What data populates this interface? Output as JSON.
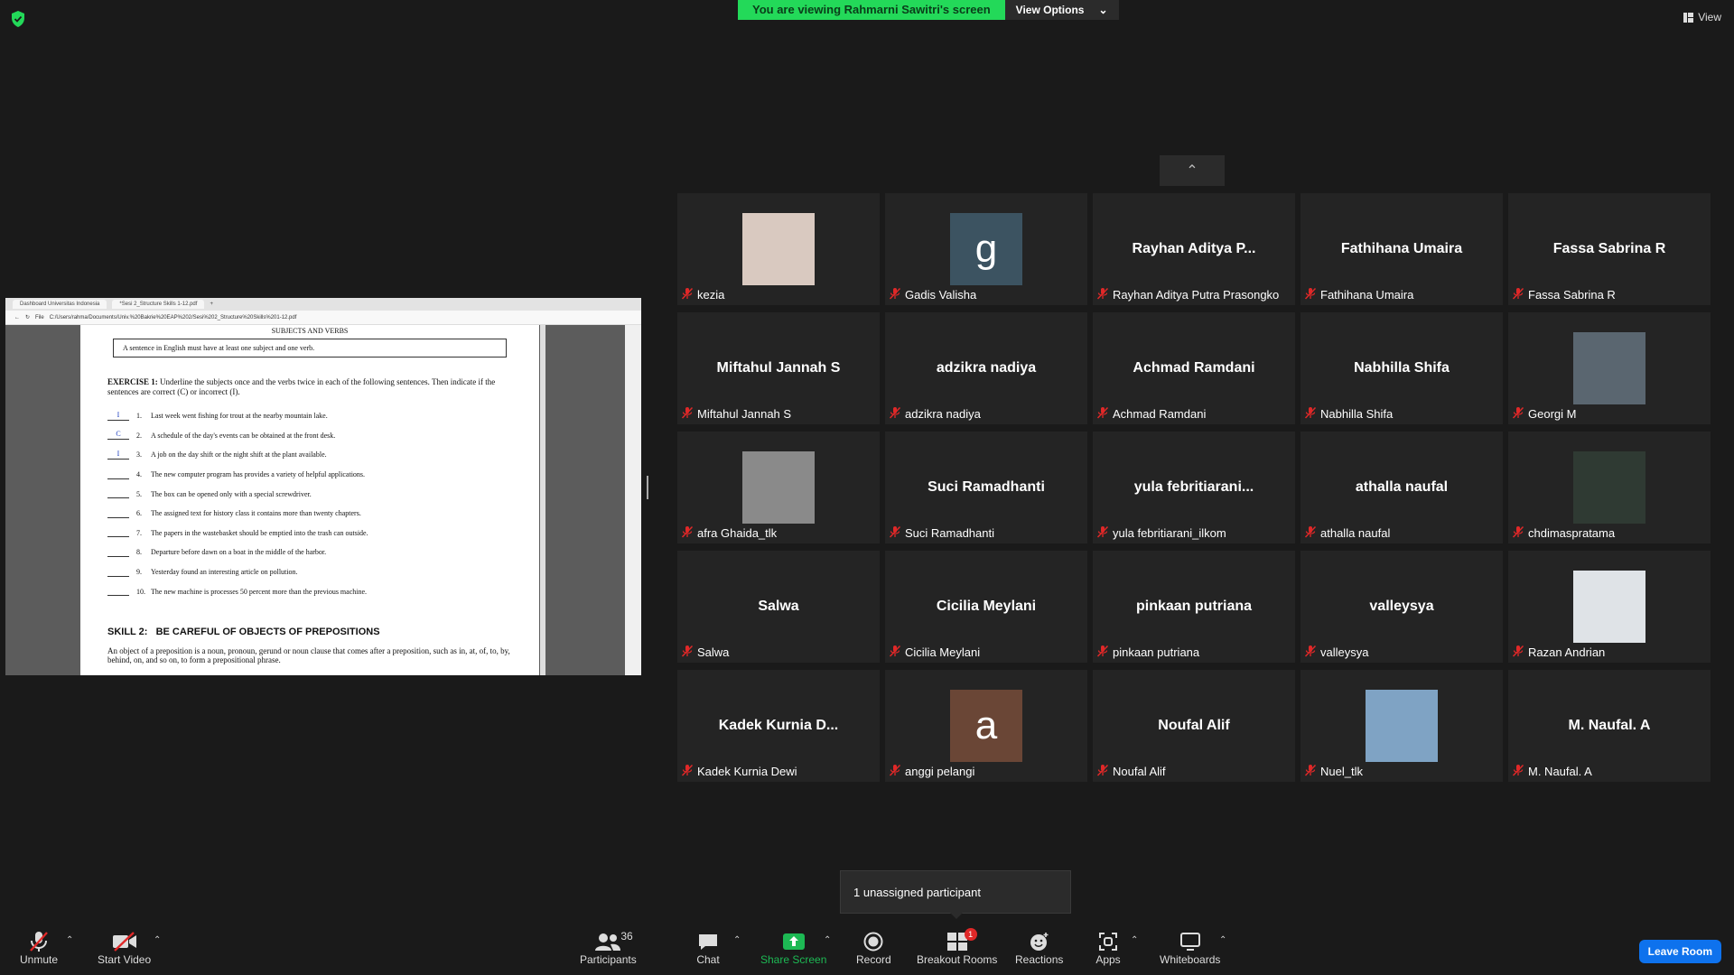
{
  "top_bar": {
    "viewing_text": "You are viewing Rahmarni Sawitri's screen",
    "view_options_label": "View Options",
    "view_label": "View"
  },
  "shared_screen": {
    "browser_tabs": [
      "Dashboard Universitas Indonesia",
      "*Sesi 2_Structure Skills 1-12.pdf"
    ],
    "address_prefix": "File",
    "address": "C:/Users/rahma/Documents/Univ.%20Bakrie%20EAP%202/Sesi%202_Structure%20Skills%201-12.pdf",
    "pdf": {
      "section_title": "SUBJECTS AND VERBS",
      "rule_box": "A sentence in English must have at least one subject and one verb.",
      "exercise_label": "EXERCISE 1:",
      "exercise_text": "Underline the subjects once and the verbs twice in each of the following sentences. Then indicate if the sentences are correct (C) or incorrect (I).",
      "items": [
        {
          "mark": "I",
          "num": "1.",
          "text": "Last week went fishing for trout at the nearby mountain lake."
        },
        {
          "mark": "C",
          "num": "2.",
          "text": "A schedule of the day's events can be obtained at the front desk."
        },
        {
          "mark": "I",
          "num": "3.",
          "text": "A job on the day shift or the night shift at the plant available."
        },
        {
          "mark": "",
          "num": "4.",
          "text": "The new computer program has provides a variety of helpful applications."
        },
        {
          "mark": "",
          "num": "5.",
          "text": "The box can be opened only with a special screwdriver."
        },
        {
          "mark": "",
          "num": "6.",
          "text": "The assigned text for history class it contains more than twenty chapters."
        },
        {
          "mark": "",
          "num": "7.",
          "text": "The papers in the wastebasket should be emptied into the trash can outside."
        },
        {
          "mark": "",
          "num": "8.",
          "text": "Departure before dawn on a boat in the middle of the harbor."
        },
        {
          "mark": "",
          "num": "9.",
          "text": "Yesterday found an interesting article on pollution."
        },
        {
          "mark": "",
          "num": "10.",
          "text": "The new machine is processes 50 percent more than the previous machine."
        }
      ],
      "skill_label": "SKILL 2:",
      "skill_title": "BE CAREFUL OF OBJECTS OF PREPOSITIONS",
      "skill_para": "An object of a preposition is a noun, pronoun, gerund or noun clause that comes after a preposition, such as in, at, of, to, by, behind, on, and so on, to form a prepositional phrase."
    }
  },
  "participants": [
    {
      "display": "",
      "avatar": "photo",
      "color": "#d9c9c0",
      "label": "kezia"
    },
    {
      "display": "g",
      "avatar": "letter",
      "color": "#3c5361",
      "label": "Gadis Valisha"
    },
    {
      "display": "Rayhan  Aditya  P...",
      "avatar": "name",
      "label": "Rayhan Aditya Putra Prasongko"
    },
    {
      "display": "Fathihana Umaira",
      "avatar": "name",
      "label": "Fathihana Umaira"
    },
    {
      "display": "Fassa Sabrina R",
      "avatar": "name",
      "label": "Fassa Sabrina R"
    },
    {
      "display": "Miftahul Jannah S",
      "avatar": "name",
      "label": "Miftahul Jannah S"
    },
    {
      "display": "adzikra nadiya",
      "avatar": "name",
      "label": "adzikra nadiya"
    },
    {
      "display": "Achmad Ramdani",
      "avatar": "name",
      "label": "Achmad Ramdani"
    },
    {
      "display": "Nabhilla Shifa",
      "avatar": "name",
      "label": "Nabhilla Shifa"
    },
    {
      "display": "",
      "avatar": "photo",
      "color": "#5a6670",
      "label": "Georgi M"
    },
    {
      "display": "",
      "avatar": "photo",
      "color": "#8a8a8a",
      "label": "afra Ghaida_tlk"
    },
    {
      "display": "Suci Ramadhanti",
      "avatar": "name",
      "label": "Suci Ramadhanti"
    },
    {
      "display": "yula  febritiarani...",
      "avatar": "name",
      "label": "yula febritiarani_ilkom"
    },
    {
      "display": "athalla naufal",
      "avatar": "name",
      "label": "athalla naufal"
    },
    {
      "display": "",
      "avatar": "photo",
      "color": "#2f3a33",
      "label": "chdimaspratama"
    },
    {
      "display": "Salwa",
      "avatar": "name",
      "label": "Salwa"
    },
    {
      "display": "Cicilia Meylani",
      "avatar": "name",
      "label": "Cicilia Meylani"
    },
    {
      "display": "pinkaan putriana",
      "avatar": "name",
      "label": "pinkaan putriana"
    },
    {
      "display": "valleysya",
      "avatar": "name",
      "label": "valleysya"
    },
    {
      "display": "",
      "avatar": "photo",
      "color": "#dfe3e7",
      "label": "Razan Andrian"
    },
    {
      "display": "Kadek  Kurnia  D...",
      "avatar": "name",
      "label": "Kadek Kurnia Dewi"
    },
    {
      "display": "a",
      "avatar": "letter",
      "color": "#6a4636",
      "label": "anggi pelangi"
    },
    {
      "display": "Noufal Alif",
      "avatar": "name",
      "label": "Noufal Alif"
    },
    {
      "display": "",
      "avatar": "photo",
      "color": "#7fa3c4",
      "label": "Nuel_tlk"
    },
    {
      "display": "M. Naufal. A",
      "avatar": "name",
      "label": "M. Naufal. A"
    }
  ],
  "unassigned_tooltip": "1 unassigned participant",
  "toolbar": {
    "unmute": "Unmute",
    "start_video": "Start Video",
    "participants": "Participants",
    "participants_count": "36",
    "chat": "Chat",
    "share_screen": "Share Screen",
    "record": "Record",
    "breakout_rooms": "Breakout Rooms",
    "breakout_badge": "1",
    "reactions": "Reactions",
    "apps": "Apps",
    "whiteboards": "Whiteboards",
    "leave_room": "Leave Room"
  },
  "colors": {
    "banner_green": "#23d959",
    "leave_blue": "#0e72ed",
    "share_green": "#1db954",
    "mic_off_red": "#e02828"
  }
}
